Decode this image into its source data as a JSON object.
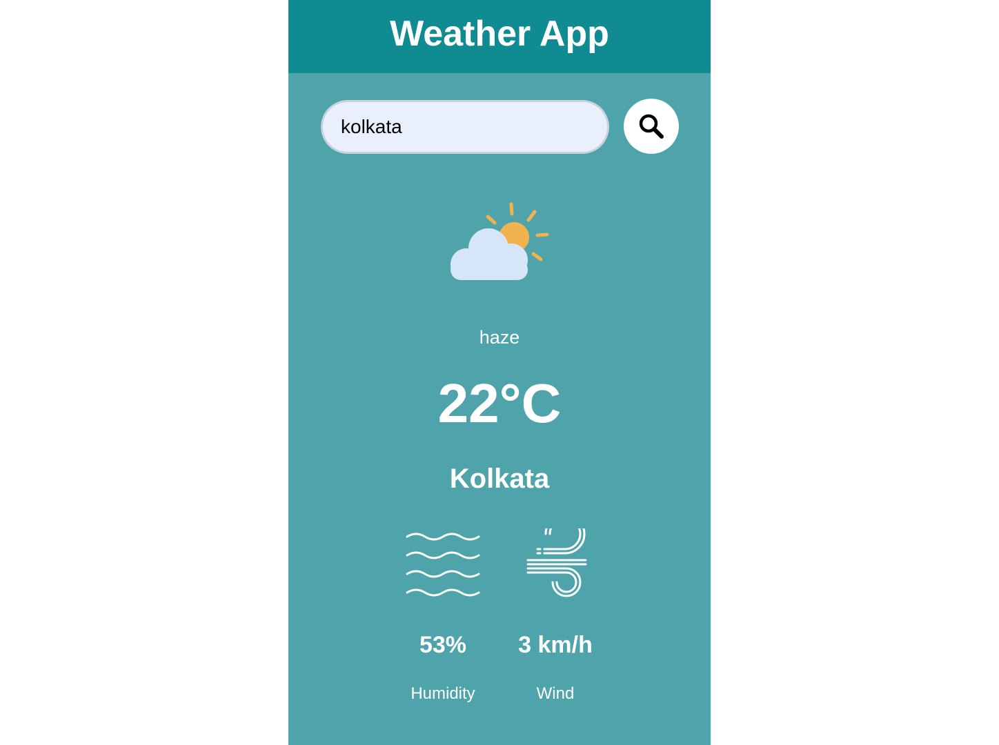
{
  "header": {
    "title": "Weather App"
  },
  "search": {
    "value": "kolkata",
    "button_icon": "search-icon"
  },
  "weather": {
    "icon": "partly-cloudy-icon",
    "condition": "haze",
    "temperature": "22°C",
    "city": "Kolkata"
  },
  "details": {
    "humidity": {
      "icon": "humidity-waves-icon",
      "value": "53%",
      "label": "Humidity"
    },
    "wind": {
      "icon": "wind-icon",
      "value": "3 km/h",
      "label": "Wind"
    }
  },
  "colors": {
    "header_bg": "#0f8b91",
    "app_bg": "#4fa3aa",
    "input_bg": "#eaf0fb",
    "sun": "#f2b24e",
    "cloud": "#d4e6f7",
    "text": "#ffffff"
  }
}
